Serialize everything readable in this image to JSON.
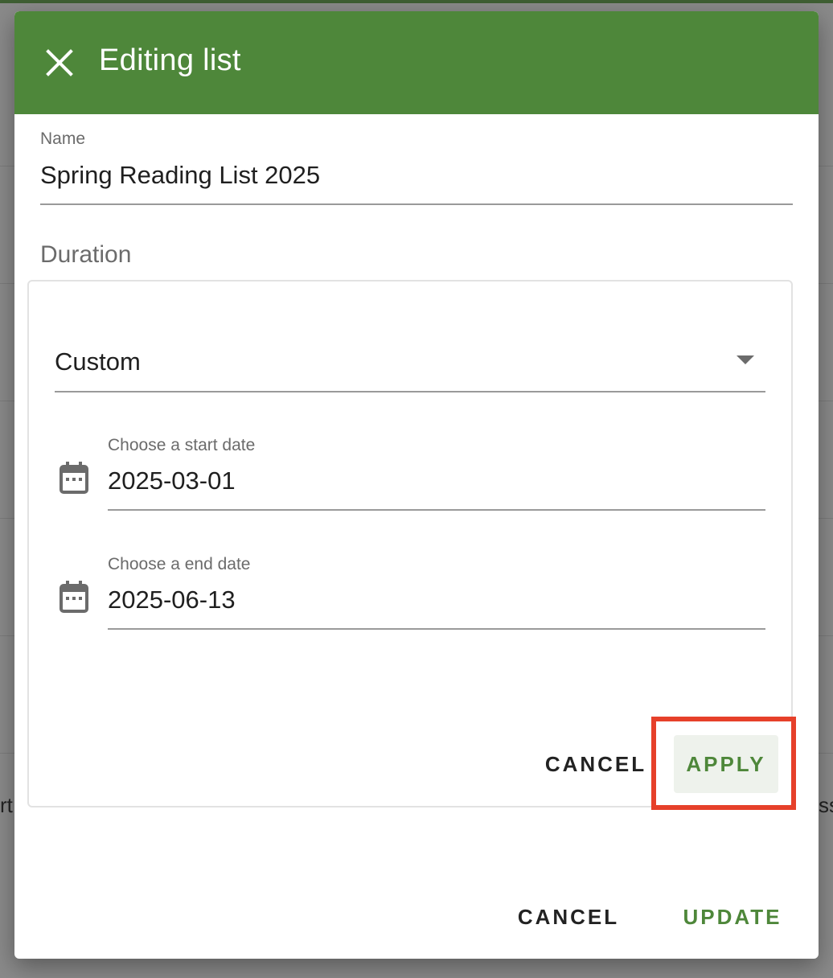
{
  "dialog": {
    "title": "Editing list",
    "close_icon": "close-icon"
  },
  "name_field": {
    "label": "Name",
    "value": "Spring Reading List 2025"
  },
  "duration": {
    "label": "Duration",
    "select_value": "Custom",
    "start_date": {
      "label": "Choose a start date",
      "value": "2025-03-01",
      "icon": "calendar-icon"
    },
    "end_date": {
      "label": "Choose a end date",
      "value": "2025-06-13",
      "icon": "calendar-icon"
    },
    "cancel_label": "CANCEL",
    "apply_label": "APPLY"
  },
  "footer": {
    "cancel_label": "CANCEL",
    "update_label": "UPDATE"
  },
  "background": {
    "left_fragment": "rt",
    "right_fragment": "ss"
  },
  "colors": {
    "header": "#4e873a",
    "accent": "#4e873a",
    "highlight": "#e6402a"
  }
}
